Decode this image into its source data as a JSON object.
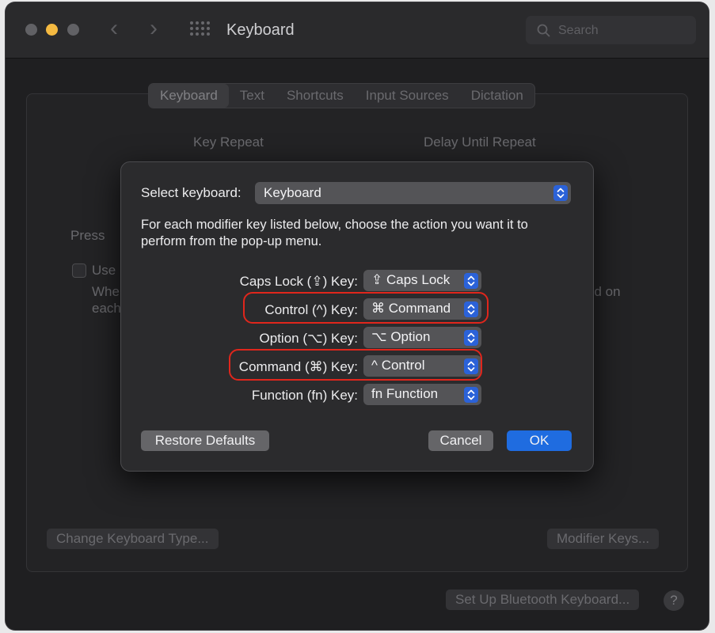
{
  "window": {
    "title": "Keyboard"
  },
  "search": {
    "placeholder": "Search"
  },
  "tabs": [
    {
      "label": "Keyboard",
      "selected": true
    },
    {
      "label": "Text",
      "selected": false
    },
    {
      "label": "Shortcuts",
      "selected": false
    },
    {
      "label": "Input Sources",
      "selected": false
    },
    {
      "label": "Dictation",
      "selected": false
    }
  ],
  "background": {
    "key_repeat_label": "Key Repeat",
    "delay_label": "Delay Until Repeat",
    "press_text": "Press",
    "use_text": "Use",
    "when_text": "Whe",
    "each_text": "each",
    "ed_on_text": "ed on",
    "change_keyboard_type_button": "Change Keyboard Type...",
    "modifier_keys_button": "Modifier Keys...",
    "bluetooth_button": "Set Up Bluetooth Keyboard...",
    "help_button": "?"
  },
  "sheet": {
    "select_keyboard_label": "Select keyboard:",
    "select_keyboard_value": "Keyboard",
    "instructions": "For each modifier key listed below, choose the action you want it to perform from the pop-up menu.",
    "modifiers": [
      {
        "label": "Caps Lock (⇪) Key:",
        "value": "⇪ Caps Lock",
        "highlighted": false
      },
      {
        "label": "Control (^) Key:",
        "value": "⌘ Command",
        "highlighted": true
      },
      {
        "label": "Option (⌥) Key:",
        "value": "⌥ Option",
        "highlighted": false
      },
      {
        "label": "Command (⌘) Key:",
        "value": "^ Control",
        "highlighted": true
      },
      {
        "label": "Function (fn) Key:",
        "value": "fn Function",
        "highlighted": false
      }
    ],
    "restore_defaults_button": "Restore Defaults",
    "cancel_button": "Cancel",
    "ok_button": "OK"
  },
  "colors": {
    "accent": "#1f6ce0",
    "highlight": "#e0261c",
    "traffic_minimize": "#f4b941"
  },
  "icons": {
    "search": "magnifier-icon",
    "grid": "grid-icon",
    "stepper": "up-down-chevron-icon"
  }
}
